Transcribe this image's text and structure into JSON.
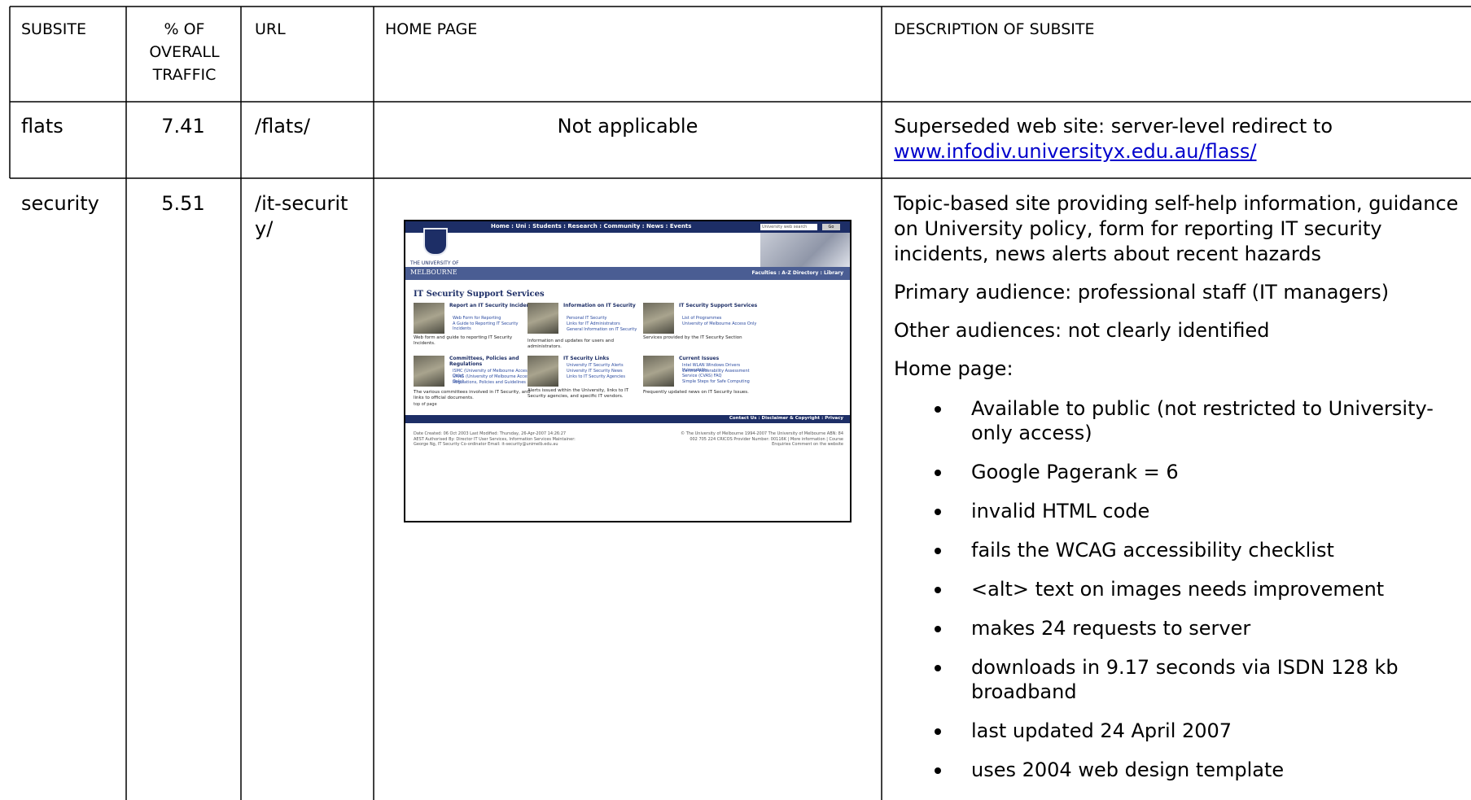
{
  "headers": {
    "subsite": "SUBSITE",
    "traffic": "% OF OVERALL TRAFFIC",
    "url": "URL",
    "home_page": "HOME PAGE",
    "description": "DESCRIPTION OF SUBSITE"
  },
  "rows": [
    {
      "subsite": "flats",
      "traffic": "7.41",
      "url": "/flats/",
      "home_page": "Not applicable",
      "description_text": "Superseded web site: server-level redirect to",
      "description_link": "www.infodiv.universityx.edu.au/flass/"
    },
    {
      "subsite": "security",
      "traffic": "5.51",
      "url": "/it-security/",
      "description": {
        "summary": "Topic-based site providing self-help information, guidance on University policy, form for reporting IT security incidents, news alerts about recent hazards",
        "primary_audience": "Primary audience: professional staff (IT managers)",
        "other_audiences": "Other audiences: not clearly identified",
        "home_page_label": "Home page:",
        "bullets": [
          "Available to public (not restricted to University-only access)",
          "Google Pagerank = 6",
          "invalid HTML code",
          "fails the WCAG accessibility checklist",
          "<alt> text on images needs improvement",
          "makes 24 requests to server",
          "downloads in 9.17 seconds via ISDN 128 kb broadband",
          "last updated 24 April 2007",
          "uses 2004 web design template"
        ]
      }
    }
  ],
  "thumbnail": {
    "top_links": "Home : Uni : Students : Research : Community : News : Events",
    "search_placeholder": "University web search",
    "go_label": "Go",
    "university_small": "THE UNIVERSITY OF",
    "university_name": "MELBOURNE",
    "faculty_links": "Faculties : A-Z Directory : Library",
    "page_title": "IT Security Support Services",
    "blocks": [
      {
        "heading": "Report an IT Security Incident",
        "links": [
          "Web Form for Reporting",
          "A Guide to Reporting IT Security Incidents"
        ],
        "text": "Web form and guide to reporting IT Security Incidents."
      },
      {
        "heading": "Information on IT Security",
        "links": [
          "Personal IT Security",
          "Links for IT Administrators",
          "General Information on IT Security"
        ],
        "text": "Information and updates for users and administrators."
      },
      {
        "heading": "IT Security Support Services",
        "links": [
          "List of Programmes",
          "University of Melbourne Access Only"
        ],
        "text": "Services provided by the IT Security Section"
      },
      {
        "heading": "Committees, Policies and Regulations",
        "links": [
          "ISMC (University of Melbourne Access Only)",
          "UAAG (University of Melbourne Access Only)",
          "Regulations, Policies and Guidelines"
        ],
        "text": "The various committees involved in IT Security, and links to official documents."
      },
      {
        "heading": "IT Security Links",
        "links": [
          "University IT Security Alerts",
          "University IT Security News",
          "Links to IT Security Agencies"
        ],
        "text": "Alerts issued within the University, links to IT Security agencies, and specific IT vendors."
      },
      {
        "heading": "Current Issues",
        "links": [
          "Intel WLAN Windows Drivers Vulnerability",
          "Central Vulnerability Assessment Service (CVAS) FAQ",
          "Simple Steps for Safe Computing"
        ],
        "text": "Frequently updated news on IT Security Issues."
      }
    ],
    "top_of_page": "top of page",
    "footer_links": "Contact Us : Disclaimer & Copyright : Privacy",
    "footer_left": "Date Created: 06 Oct 2003 Last Modified: Thursday, 26-Apr-2007 14:26:27 AEST Authorised By: Director IT User Services, Information Services Maintainer: George Ng, IT Security Co-ordinator Email: it-security@unimelb.edu.au",
    "footer_right": "© The University of Melbourne 1994-2007 The University of Melbourne ABN: 84 002 705 224 CRICOS Provider Number: 00116K | More information | Course Enquiries Comment on the website"
  }
}
